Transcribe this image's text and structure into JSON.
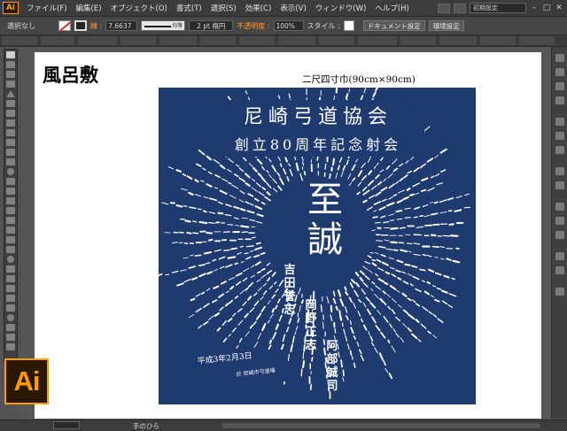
{
  "app": {
    "badge": "Ai",
    "logo": "Ai"
  },
  "menu": {
    "items": [
      "ファイル(F)",
      "編集(E)",
      "オブジェクト(O)",
      "書式(T)",
      "選択(S)",
      "効果(C)",
      "表示(V)",
      "ウィンドウ(W)",
      "ヘルプ(H)"
    ],
    "workspace": "初期設定"
  },
  "control": {
    "selection": "選択なし",
    "stroke_label": "線 :",
    "stroke_weight": "7.6637",
    "stroke_profile": "均等",
    "brush": "2 pt 楕円",
    "opacity_label": "不透明度 :",
    "opacity_value": "100%",
    "style_label": "スタイル :",
    "doc_settings": "ドキュメント設定",
    "env_settings": "環境設定"
  },
  "artboard": {
    "title": "風呂敷",
    "dimension": "二尺四寸巾(90cm×90cm)"
  },
  "furoshiki": {
    "color": "#1f3a6e",
    "line1": "尼崎弓道協会",
    "line2": "創立80周年記念射会",
    "center_top": "至",
    "center_bottom": "誠",
    "date": "平成3年2月3日",
    "date_sub": "於 尼崎市弓道場",
    "inner_names": [
      "吉",
      "田",
      "誉",
      "志",
      "岡",
      "野",
      "正",
      "志",
      "阿",
      "部",
      "誠",
      "司"
    ]
  },
  "status": {
    "zoom": "",
    "tool": "手のひら"
  },
  "colors": {
    "accent": "#ff9a00",
    "ui_bg": "#535353",
    "cloth": "#1f3a6e"
  }
}
